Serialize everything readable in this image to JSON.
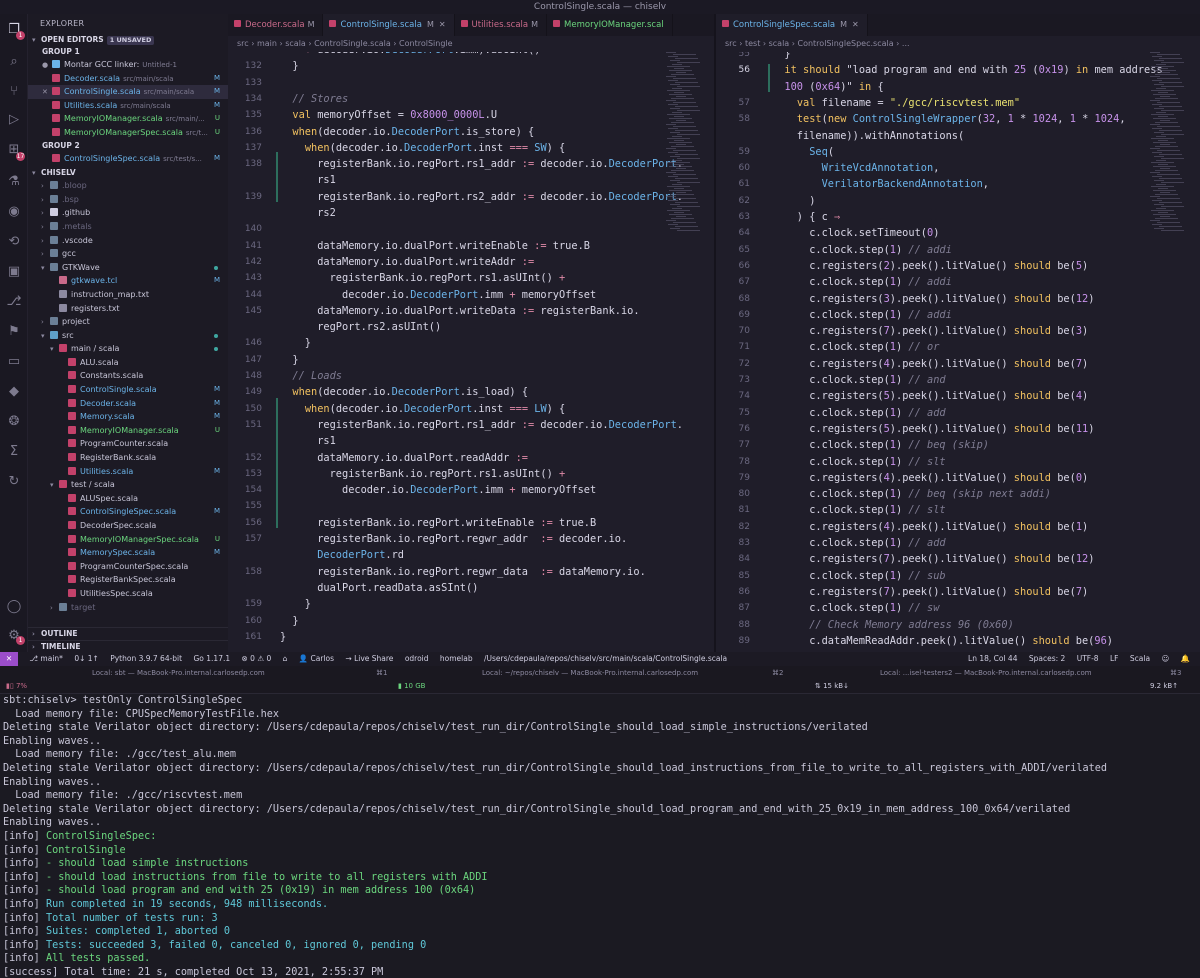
{
  "window": {
    "title": "ControlSingle.scala — chiselv"
  },
  "sidebar": {
    "header": "EXPLORER",
    "open_editors": {
      "label": "OPEN EDITORS",
      "unsaved": "1 UNSAVED",
      "group1": "GROUP 1",
      "group1_items": [
        {
          "name": "Montar GCC linker:",
          "sub": "Untitled-1",
          "status": ""
        },
        {
          "name": "Decoder.scala",
          "sub": "src/main/scala",
          "status": "M"
        },
        {
          "name": "ControlSingle.scala",
          "sub": "src/main/scala",
          "status": "M"
        },
        {
          "name": "Utilities.scala",
          "sub": "src/main/scala",
          "status": "M"
        },
        {
          "name": "MemoryIOManager.scala",
          "sub": "src/main/...",
          "status": "U"
        },
        {
          "name": "MemoryIOManagerSpec.scala",
          "sub": "src/t...",
          "status": "U"
        }
      ],
      "group2": "GROUP 2",
      "group2_items": [
        {
          "name": "ControlSingleSpec.scala",
          "sub": "src/test/s...",
          "status": "M"
        }
      ]
    },
    "project": "CHISELV",
    "tree": [
      {
        "name": ".bloop",
        "status": ""
      },
      {
        "name": ".bsp",
        "status": ""
      },
      {
        "name": ".github",
        "status": ""
      },
      {
        "name": ".metals",
        "status": ""
      },
      {
        "name": ".vscode",
        "status": ""
      },
      {
        "name": "gcc",
        "status": ""
      },
      {
        "name": "GTKWave",
        "status": ""
      },
      {
        "name": "gtkwave.tcl",
        "status": "M"
      },
      {
        "name": "instruction_map.txt",
        "status": ""
      },
      {
        "name": "registers.txt",
        "status": ""
      },
      {
        "name": "project",
        "status": ""
      },
      {
        "name": "src",
        "status": ""
      },
      {
        "name": "main / scala",
        "status": ""
      },
      {
        "name": "ALU.scala",
        "status": ""
      },
      {
        "name": "Constants.scala",
        "status": ""
      },
      {
        "name": "ControlSingle.scala",
        "status": "M"
      },
      {
        "name": "Decoder.scala",
        "status": "M"
      },
      {
        "name": "Memory.scala",
        "status": "M"
      },
      {
        "name": "MemoryIOManager.scala",
        "status": "U"
      },
      {
        "name": "ProgramCounter.scala",
        "status": ""
      },
      {
        "name": "RegisterBank.scala",
        "status": ""
      },
      {
        "name": "Utilities.scala",
        "status": "M"
      },
      {
        "name": "test / scala",
        "status": ""
      },
      {
        "name": "ALUSpec.scala",
        "status": ""
      },
      {
        "name": "ControlSingleSpec.scala",
        "status": "M"
      },
      {
        "name": "DecoderSpec.scala",
        "status": ""
      },
      {
        "name": "MemoryIOManagerSpec.scala",
        "status": "U"
      },
      {
        "name": "MemorySpec.scala",
        "status": "M"
      },
      {
        "name": "ProgramCounterSpec.scala",
        "status": ""
      },
      {
        "name": "RegisterBankSpec.scala",
        "status": ""
      },
      {
        "name": "UtilitiesSpec.scala",
        "status": ""
      },
      {
        "name": "target",
        "status": ""
      }
    ],
    "outline": "OUTLINE",
    "timeline": "TIMELINE"
  },
  "editor1": {
    "tabs": [
      {
        "label": "Decoder.scala",
        "mark": "M"
      },
      {
        "label": "ControlSingle.scala",
        "mark": "M"
      },
      {
        "label": "Utilities.scala",
        "mark": "M"
      },
      {
        "label": "MemoryIOManager.scal",
        "mark": ""
      }
    ],
    "breadcrumb": "src › main › scala › ControlSingle.scala › ControlSingle",
    "lines": [
      {
        "n": "",
        "t": "    + decoder.io.DecoderPort.imm).asUInt()"
      },
      {
        "n": "132",
        "t": "  }"
      },
      {
        "n": "133",
        "t": ""
      },
      {
        "n": "134",
        "t": "  // Stores"
      },
      {
        "n": "135",
        "t": "  val memoryOffset = 0x8000_0000L.U"
      },
      {
        "n": "136",
        "t": "  when(decoder.io.DecoderPort.is_store) {"
      },
      {
        "n": "137",
        "t": "    when(decoder.io.DecoderPort.inst === SW) {"
      },
      {
        "n": "138",
        "t": "      registerBank.io.regPort.rs1_addr := decoder.io.DecoderPort."
      },
      {
        "n": "",
        "t": "      rs1"
      },
      {
        "n": "139",
        "t": "      registerBank.io.regPort.rs2_addr := decoder.io.DecoderPort."
      },
      {
        "n": "",
        "t": "      rs2"
      },
      {
        "n": "140",
        "t": ""
      },
      {
        "n": "141",
        "t": "      dataMemory.io.dualPort.writeEnable := true.B"
      },
      {
        "n": "142",
        "t": "      dataMemory.io.dualPort.writeAddr :="
      },
      {
        "n": "143",
        "t": "        registerBank.io.regPort.rs1.asUInt() +"
      },
      {
        "n": "144",
        "t": "          decoder.io.DecoderPort.imm + memoryOffset"
      },
      {
        "n": "145",
        "t": "      dataMemory.io.dualPort.writeData := registerBank.io."
      },
      {
        "n": "",
        "t": "      regPort.rs2.asUInt()"
      },
      {
        "n": "146",
        "t": "    }"
      },
      {
        "n": "147",
        "t": "  }"
      },
      {
        "n": "148",
        "t": "  // Loads"
      },
      {
        "n": "149",
        "t": "  when(decoder.io.DecoderPort.is_load) {"
      },
      {
        "n": "150",
        "t": "    when(decoder.io.DecoderPort.inst === LW) {"
      },
      {
        "n": "151",
        "t": "      registerBank.io.regPort.rs1_addr := decoder.io.DecoderPort."
      },
      {
        "n": "",
        "t": "      rs1"
      },
      {
        "n": "152",
        "t": "      dataMemory.io.dualPort.readAddr :="
      },
      {
        "n": "153",
        "t": "        registerBank.io.regPort.rs1.asUInt() +"
      },
      {
        "n": "154",
        "t": "          decoder.io.DecoderPort.imm + memoryOffset"
      },
      {
        "n": "155",
        "t": ""
      },
      {
        "n": "156",
        "t": "      registerBank.io.regPort.writeEnable := true.B"
      },
      {
        "n": "157",
        "t": "      registerBank.io.regPort.regwr_addr  := decoder.io."
      },
      {
        "n": "",
        "t": "      DecoderPort.rd"
      },
      {
        "n": "158",
        "t": "      registerBank.io.regPort.regwr_data  := dataMemory.io."
      },
      {
        "n": "",
        "t": "      dualPort.readData.asSInt()"
      },
      {
        "n": "159",
        "t": "    }"
      },
      {
        "n": "160",
        "t": "  }"
      },
      {
        "n": "161",
        "t": "}"
      }
    ]
  },
  "editor2": {
    "tabs": [
      {
        "label": "ControlSingleSpec.scala",
        "mark": "M"
      }
    ],
    "breadcrumb": "src › test › scala › ControlSingleSpec.scala › ...",
    "lines": [
      {
        "n": "55",
        "t": "  }"
      },
      {
        "n": "56",
        "t": "  it should \"load program and end with 25 (0x19) in mem address"
      },
      {
        "n": "",
        "t": "  100 (0x64)\" in {"
      },
      {
        "n": "57",
        "t": "    val filename = \"./gcc/riscvtest.mem\""
      },
      {
        "n": "58",
        "t": "    test(new ControlSingleWrapper(32, 1 * 1024, 1 * 1024,"
      },
      {
        "n": "",
        "t": "    filename)).withAnnotations("
      },
      {
        "n": "59",
        "t": "      Seq("
      },
      {
        "n": "60",
        "t": "        WriteVcdAnnotation,"
      },
      {
        "n": "61",
        "t": "        VerilatorBackendAnnotation,"
      },
      {
        "n": "62",
        "t": "      )"
      },
      {
        "n": "63",
        "t": "    ) { c ⇒"
      },
      {
        "n": "64",
        "t": "      c.clock.setTimeout(0)"
      },
      {
        "n": "65",
        "t": "      c.clock.step(1) // addi"
      },
      {
        "n": "66",
        "t": "      c.registers(2).peek().litValue() should be(5)"
      },
      {
        "n": "67",
        "t": "      c.clock.step(1) // addi"
      },
      {
        "n": "68",
        "t": "      c.registers(3).peek().litValue() should be(12)"
      },
      {
        "n": "69",
        "t": "      c.clock.step(1) // addi"
      },
      {
        "n": "70",
        "t": "      c.registers(7).peek().litValue() should be(3)"
      },
      {
        "n": "71",
        "t": "      c.clock.step(1) // or"
      },
      {
        "n": "72",
        "t": "      c.registers(4).peek().litValue() should be(7)"
      },
      {
        "n": "73",
        "t": "      c.clock.step(1) // and"
      },
      {
        "n": "74",
        "t": "      c.registers(5).peek().litValue() should be(4)"
      },
      {
        "n": "75",
        "t": "      c.clock.step(1) // add"
      },
      {
        "n": "76",
        "t": "      c.registers(5).peek().litValue() should be(11)"
      },
      {
        "n": "77",
        "t": "      c.clock.step(1) // beq (skip)"
      },
      {
        "n": "78",
        "t": "      c.clock.step(1) // slt"
      },
      {
        "n": "79",
        "t": "      c.registers(4).peek().litValue() should be(0)"
      },
      {
        "n": "80",
        "t": "      c.clock.step(1) // beq (skip next addi)"
      },
      {
        "n": "81",
        "t": "      c.clock.step(1) // slt"
      },
      {
        "n": "82",
        "t": "      c.registers(4).peek().litValue() should be(1)"
      },
      {
        "n": "83",
        "t": "      c.clock.step(1) // add"
      },
      {
        "n": "84",
        "t": "      c.registers(7).peek().litValue() should be(12)"
      },
      {
        "n": "85",
        "t": "      c.clock.step(1) // sub"
      },
      {
        "n": "86",
        "t": "      c.registers(7).peek().litValue() should be(7)"
      },
      {
        "n": "87",
        "t": "      c.clock.step(1) // sw"
      },
      {
        "n": "88",
        "t": "      // Check Memory address 96 (0x60)"
      },
      {
        "n": "89",
        "t": "      c.dataMemReadAddr.peek().litValue() should be(96)"
      }
    ]
  },
  "statusbar": {
    "branch": "main*",
    "sync": "0↓ 1↑",
    "python": "Python 3.9.7 64-bit",
    "go": "Go 1.17.1",
    "problems": "⊗ 0 ⚠ 0",
    "user": "Carlos",
    "liveshare": "Live Share",
    "arch": "odroid",
    "host": "homelab",
    "path": "/Users/cdepaula/repos/chiselv/src/main/scala/ControlSingle.scala",
    "position": "Ln 18, Col 44",
    "spaces": "Spaces: 2",
    "encoding": "UTF-8",
    "eol": "LF",
    "language": "Scala"
  },
  "terminal": {
    "tabs": [
      {
        "label": "Local: sbt — MacBook-Pro.internal.carlosedp.com",
        "key": "⌘1"
      },
      {
        "label": "Local: ~/repos/chiselv — MacBook-Pro.internal.carlosedp.com",
        "key": "⌘2"
      },
      {
        "label": "Local: ...isel-testers2 — MacBook-Pro.internal.carlosedp.com",
        "key": "⌘3"
      }
    ],
    "stats": {
      "cpu": "7%",
      "mem": "10 GB",
      "net_down": "15 kB↓",
      "net_up": "9.2 kB↑"
    },
    "lines": [
      {
        "t": "sbt:chiselv> testOnly ControlSingleSpec",
        "c": "w"
      },
      {
        "t": "  Load memory file: CPUSpecMemoryTestFile.hex",
        "c": "w"
      },
      {
        "t": "Deleting stale Verilator object directory: /Users/cdepaula/repos/chiselv/test_run_dir/ControlSingle_should_load_simple_instructions/verilated",
        "c": "w"
      },
      {
        "t": "Enabling waves..",
        "c": "w"
      },
      {
        "t": "  Load memory file: ./gcc/test_alu.mem",
        "c": "w"
      },
      {
        "t": "Deleting stale Verilator object directory: /Users/cdepaula/repos/chiselv/test_run_dir/ControlSingle_should_load_instructions_from_file_to_write_to_all_registers_with_ADDI/verilated",
        "c": "w"
      },
      {
        "t": "Enabling waves..",
        "c": "w"
      },
      {
        "t": "  Load memory file: ./gcc/riscvtest.mem",
        "c": "w"
      },
      {
        "t": "Deleting stale Verilator object directory: /Users/cdepaula/repos/chiselv/test_run_dir/ControlSingle_should_load_program_and_end_with_25_0x19_in_mem_address_100_0x64/verilated",
        "c": "w"
      },
      {
        "t": "Enabling waves..",
        "c": "w"
      },
      {
        "t": "[info] ControlSingleSpec:",
        "c": "g"
      },
      {
        "t": "[info] ControlSingle",
        "c": "g"
      },
      {
        "t": "[info] - should load simple instructions",
        "c": "g"
      },
      {
        "t": "[info] - should load instructions from file to write to all registers with ADDI",
        "c": "g"
      },
      {
        "t": "[info] - should load program and end with 25 (0x19) in mem address 100 (0x64)",
        "c": "g"
      },
      {
        "t": "[info] Run completed in 19 seconds, 948 milliseconds.",
        "c": "c"
      },
      {
        "t": "[info] Total number of tests run: 3",
        "c": "c"
      },
      {
        "t": "[info] Suites: completed 1, aborted 0",
        "c": "c"
      },
      {
        "t": "[info] Tests: succeeded 3, failed 0, canceled 0, ignored 0, pending 0",
        "c": "c"
      },
      {
        "t": "[info] All tests passed.",
        "c": "g"
      },
      {
        "t": "[success] Total time: 21 s, completed Oct 13, 2021, 2:55:37 PM",
        "c": "w"
      },
      {
        "t": "sbt:chiselv> ",
        "c": "w"
      }
    ]
  },
  "colors": {
    "keyword": "#f0c060",
    "type": "#6bb3e8",
    "string": "#e8e070",
    "number": "#c792ea",
    "comment": "#7f7c92",
    "info_green": "#6bd67e",
    "info_cyan": "#5fc8d8",
    "accent": "#9b4dca"
  }
}
